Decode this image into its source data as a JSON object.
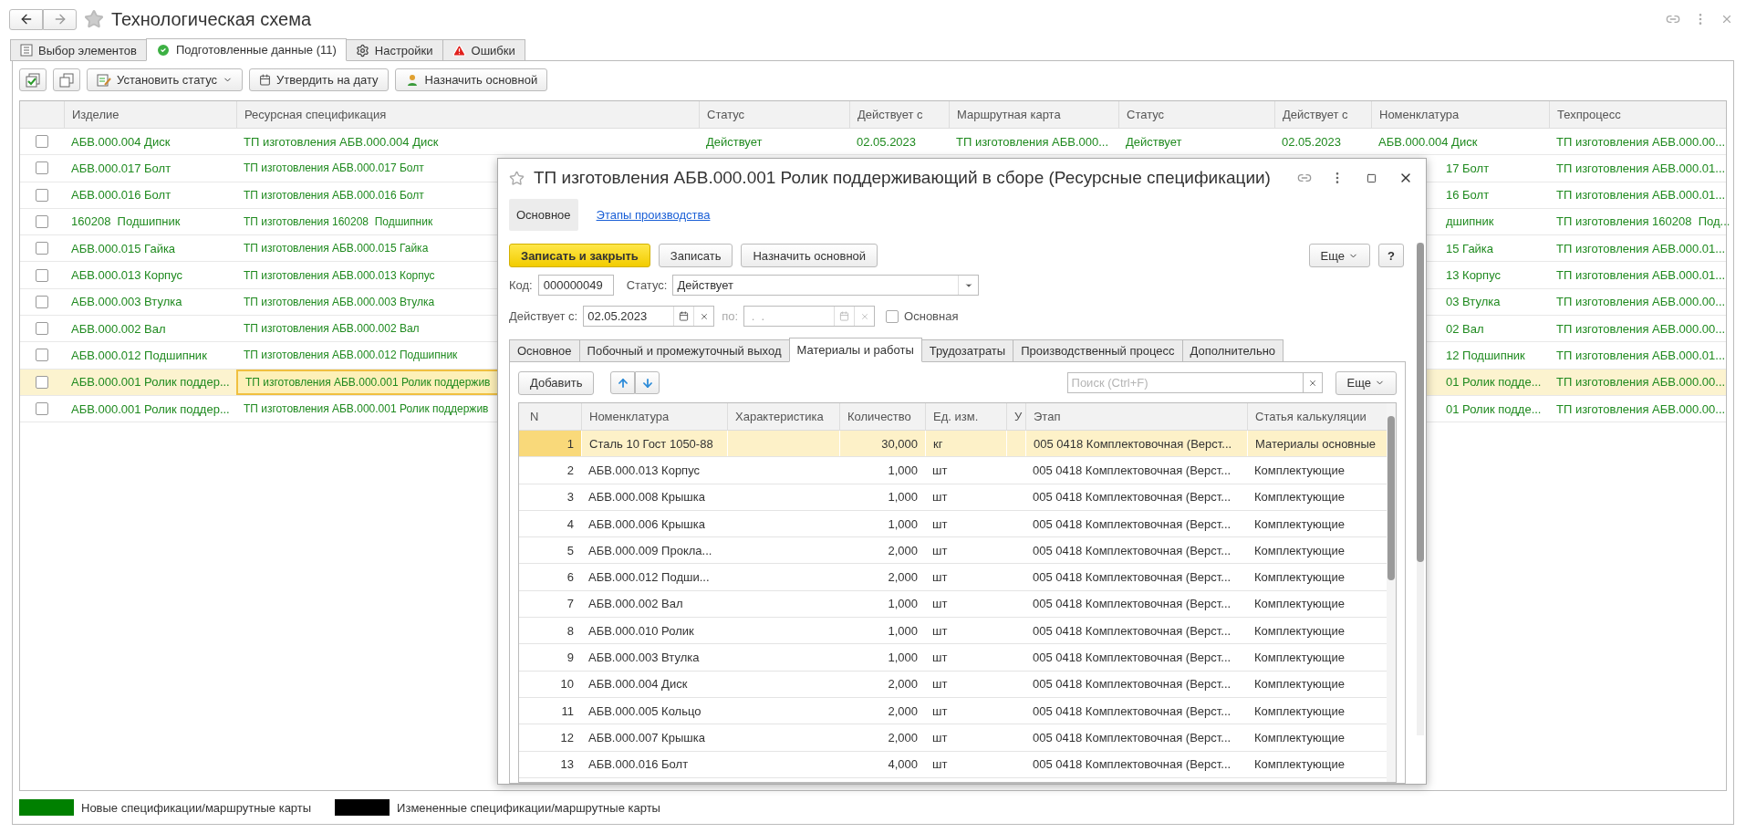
{
  "window": {
    "title": "Технологическая схема"
  },
  "tabs": [
    {
      "label": "Выбор элементов",
      "selected": false
    },
    {
      "label": "Подготовленные данные (11)",
      "selected": true
    },
    {
      "label": "Настройки",
      "selected": false
    },
    {
      "label": "Ошибки",
      "selected": false
    }
  ],
  "toolbar": {
    "buttons": [
      {
        "label": "Установить статус",
        "dropdown": true
      },
      {
        "label": "Утвердить на дату",
        "dropdown": false
      },
      {
        "label": "Назначить основной",
        "dropdown": false
      }
    ]
  },
  "table": {
    "columns": [
      "Изделие",
      "Ресурсная спецификация",
      "Статус",
      "Действует с",
      "Маршрутная карта",
      "Статус",
      "Действует с",
      "Номенклатура",
      "Техпроцесс"
    ],
    "rows": [
      {
        "checked": false,
        "selected": false,
        "cells": [
          "АБВ.000.004 Диск",
          "ТП изготовления АБВ.000.004 Диск",
          "Действует",
          "02.05.2023",
          "ТП изготовления АБВ.000...",
          "Действует",
          "02.05.2023",
          "АБВ.000.004 Диск",
          "ТП изготовления АБВ.000.00..."
        ]
      },
      {
        "checked": false,
        "selected": false,
        "cells": [
          "АБВ.000.017 Болт",
          "ТП изготовления АБВ.000.017 Болт",
          null,
          null,
          null,
          null,
          null,
          "17 Болт",
          "ТП изготовления АБВ.000.01..."
        ]
      },
      {
        "checked": false,
        "selected": false,
        "cells": [
          "АБВ.000.016 Болт",
          "ТП изготовления АБВ.000.016 Болт",
          null,
          null,
          null,
          null,
          null,
          "16 Болт",
          "ТП изготовления АБВ.000.01..."
        ]
      },
      {
        "checked": false,
        "selected": false,
        "cells": [
          "160208  Подшипник",
          "ТП изготовления 160208  Подшипник",
          null,
          null,
          null,
          null,
          null,
          "дшипник",
          "ТП изготовления 160208  Под..."
        ]
      },
      {
        "checked": false,
        "selected": false,
        "cells": [
          "АБВ.000.015 Гайка",
          "ТП изготовления АБВ.000.015 Гайка",
          null,
          null,
          null,
          null,
          null,
          "15 Гайка",
          "ТП изготовления АБВ.000.01..."
        ]
      },
      {
        "checked": false,
        "selected": false,
        "cells": [
          "АБВ.000.013 Корпус",
          "ТП изготовления АБВ.000.013 Корпус",
          null,
          null,
          null,
          null,
          null,
          "13 Корпус",
          "ТП изготовления АБВ.000.01..."
        ]
      },
      {
        "checked": false,
        "selected": false,
        "cells": [
          "АБВ.000.003 Втулка",
          "ТП изготовления АБВ.000.003 Втулка",
          null,
          null,
          null,
          null,
          null,
          "03 Втулка",
          "ТП изготовления АБВ.000.00..."
        ]
      },
      {
        "checked": false,
        "selected": false,
        "cells": [
          "АБВ.000.002 Вал",
          "ТП изготовления АБВ.000.002 Вал",
          null,
          null,
          null,
          null,
          null,
          "02 Вал",
          "ТП изготовления АБВ.000.00..."
        ]
      },
      {
        "checked": false,
        "selected": false,
        "cells": [
          "АБВ.000.012 Подшипник",
          "ТП изготовления АБВ.000.012 Подшипник",
          null,
          null,
          null,
          null,
          null,
          "12 Подшипник",
          "ТП изготовления АБВ.000.01..."
        ]
      },
      {
        "checked": false,
        "selected": true,
        "cells": [
          "АБВ.000.001 Ролик поддер...",
          "ТП изготовления АБВ.000.001 Ролик поддержив",
          null,
          null,
          null,
          null,
          null,
          "01 Ролик подде...",
          "ТП изготовления АБВ.000.00..."
        ]
      },
      {
        "checked": false,
        "selected": false,
        "cells": [
          "АБВ.000.001 Ролик поддер...",
          "ТП изготовления АБВ.000.001 Ролик поддержив",
          null,
          null,
          null,
          null,
          null,
          "01 Ролик подде...",
          "ТП изготовления АБВ.000.00..."
        ]
      }
    ]
  },
  "legend": [
    {
      "label": "Новые спецификации/маршрутные карты",
      "color": "#008000"
    },
    {
      "label": "Измененные спецификации/маршрутные карты",
      "color": "#000000"
    }
  ],
  "dialog": {
    "title": "ТП изготовления АБВ.000.001 Ролик поддерживающий в сборе (Ресурсные спецификации)",
    "nav": [
      {
        "label": "Основное",
        "selected": true
      },
      {
        "label": "Этапы производства",
        "selected": false
      }
    ],
    "buttons": [
      {
        "label": "Записать и закрыть",
        "default": true
      },
      {
        "label": "Записать",
        "default": false
      },
      {
        "label": "Назначить основной",
        "default": false
      }
    ],
    "more": "Еще",
    "help": "?",
    "code": {
      "label": "Код:",
      "value": "000000049"
    },
    "status": {
      "label": "Статус:",
      "value": "Действует"
    },
    "valid_from": {
      "label": "Действует с:",
      "value": "02.05.2023"
    },
    "valid_to": {
      "label": "по:",
      "placeholder": " .  .",
      "disabled": true
    },
    "main_checkbox": {
      "label": "Основная",
      "checked": false
    },
    "tabs": [
      {
        "label": "Основное",
        "selected": false
      },
      {
        "label": "Побочный и промежуточный выход",
        "selected": false
      },
      {
        "label": "Материалы и работы",
        "selected": true
      },
      {
        "label": "Трудозатраты",
        "selected": false
      },
      {
        "label": "Производственный процесс",
        "selected": false
      },
      {
        "label": "Дополнительно",
        "selected": false
      }
    ],
    "add_button": "Добавить",
    "search": {
      "placeholder": "Поиск (Ctrl+F)"
    },
    "table_more": "Еще",
    "table": {
      "columns": [
        "N",
        "Номенклатура",
        "Характеристика",
        "Количество",
        "Ед. изм.",
        "У",
        "Этап",
        "Статья калькуляции"
      ],
      "rows": [
        {
          "selected": true,
          "cells": [
            "1",
            "Сталь 10 Гост 1050-88",
            null,
            "30,000",
            "кг",
            null,
            "005 0418 Комплектовочная (Верст...",
            "Материалы основные"
          ]
        },
        {
          "selected": false,
          "cells": [
            "2",
            "АБВ.000.013 Корпус",
            null,
            "1,000",
            "шт",
            null,
            "005 0418 Комплектовочная (Верст...",
            "Комплектующие"
          ]
        },
        {
          "selected": false,
          "cells": [
            "3",
            "АБВ.000.008 Крышка",
            null,
            "1,000",
            "шт",
            null,
            "005 0418 Комплектовочная (Верст...",
            "Комплектующие"
          ]
        },
        {
          "selected": false,
          "cells": [
            "4",
            "АБВ.000.006 Крышка",
            null,
            "1,000",
            "шт",
            null,
            "005 0418 Комплектовочная (Верст...",
            "Комплектующие"
          ]
        },
        {
          "selected": false,
          "cells": [
            "5",
            "АБВ.000.009 Прокла...",
            null,
            "2,000",
            "шт",
            null,
            "005 0418 Комплектовочная (Верст...",
            "Комплектующие"
          ]
        },
        {
          "selected": false,
          "cells": [
            "6",
            "АБВ.000.012 Подши...",
            null,
            "2,000",
            "шт",
            null,
            "005 0418 Комплектовочная (Верст...",
            "Комплектующие"
          ]
        },
        {
          "selected": false,
          "cells": [
            "7",
            "АБВ.000.002 Вал",
            null,
            "1,000",
            "шт",
            null,
            "005 0418 Комплектовочная (Верст...",
            "Комплектующие"
          ]
        },
        {
          "selected": false,
          "cells": [
            "8",
            "АБВ.000.010 Ролик",
            null,
            "1,000",
            "шт",
            null,
            "005 0418 Комплектовочная (Верст...",
            "Комплектующие"
          ]
        },
        {
          "selected": false,
          "cells": [
            "9",
            "АБВ.000.003 Втулка",
            null,
            "1,000",
            "шт",
            null,
            "005 0418 Комплектовочная (Верст...",
            "Комплектующие"
          ]
        },
        {
          "selected": false,
          "cells": [
            "10",
            "АБВ.000.004 Диск",
            null,
            "2,000",
            "шт",
            null,
            "005 0418 Комплектовочная (Верст...",
            "Комплектующие"
          ]
        },
        {
          "selected": false,
          "cells": [
            "11",
            "АБВ.000.005 Кольцо",
            null,
            "2,000",
            "шт",
            null,
            "005 0418 Комплектовочная (Верст...",
            "Комплектующие"
          ]
        },
        {
          "selected": false,
          "cells": [
            "12",
            "АБВ.000.007 Крышка",
            null,
            "2,000",
            "шт",
            null,
            "005 0418 Комплектовочная (Верст...",
            "Комплектующие"
          ]
        },
        {
          "selected": false,
          "cells": [
            "13",
            "АБВ.000.016 Болт",
            null,
            "4,000",
            "шт",
            null,
            "005 0418 Комплектовочная (Верст...",
            "Комплектующие"
          ]
        }
      ]
    }
  }
}
